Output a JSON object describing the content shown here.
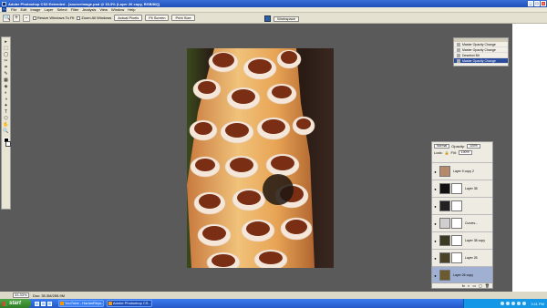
{
  "window": {
    "title": "Adobe Photoshop CS3 Extended - [sourceimage.psd @ 33.3% (Layer 26 copy, RGB/8#)]",
    "minimize": "_",
    "maximize": "□",
    "close": "x"
  },
  "menu": [
    "File",
    "Edit",
    "Image",
    "Layer",
    "Select",
    "Filter",
    "Analysis",
    "View",
    "Window",
    "Help"
  ],
  "options": {
    "tool_glyph": "🔍",
    "zoom_in": "+",
    "zoom_out": "-",
    "resize_windows": "Resize Windows To Fit",
    "zoom_all": "Zoom All Windows",
    "actual_pixels": "Actual Pixels",
    "fit_screen": "Fit Screen",
    "print_size": "Print Size",
    "workspace": "Workspace"
  },
  "tools": [
    "▸",
    "⬚",
    "◯",
    "✂",
    "⌗",
    "✎",
    "▦",
    "◈",
    "◐",
    "◑",
    "✦",
    "T",
    "⬠",
    "✋",
    "🔍"
  ],
  "history": {
    "items": [
      {
        "label": "Master Opacity Change",
        "active": false
      },
      {
        "label": "Master Opacity Change",
        "active": false
      },
      {
        "label": "Deselect Bit",
        "active": false
      },
      {
        "label": "Master Opacity Change",
        "active": true
      }
    ]
  },
  "layers": {
    "blend_mode": "Normal",
    "opacity_label": "Opacity:",
    "opacity_value": "100%",
    "lock_label": "Lock:",
    "fill_label": "Fill:",
    "fill_value": "100%",
    "rows": [
      {
        "name": "Layer 9 copy 2",
        "thumb": "#b48a6a",
        "mask": false,
        "selected": false
      },
      {
        "name": "Layer 38",
        "thumb": "#111111",
        "mask": true,
        "selected": false
      },
      {
        "name": "",
        "thumb": "#222222",
        "mask": true,
        "selected": false
      },
      {
        "name": "Curves...",
        "thumb": "#cfcfcf",
        "mask": true,
        "selected": false
      },
      {
        "name": "Layer 38 copy",
        "thumb": "#3d3a22",
        "mask": true,
        "selected": false
      },
      {
        "name": "Layer 26",
        "thumb": "#4a4226",
        "mask": true,
        "selected": false
      },
      {
        "name": "Layer 26 copy",
        "thumb": "#6b5a30",
        "mask": false,
        "selected": true
      }
    ],
    "bottom_icons": [
      "fx",
      "◐",
      "▭",
      "▢",
      "🗑"
    ]
  },
  "status": {
    "zoom": "33.33%",
    "doc_info": "Doc: 35.3M/255.9M"
  },
  "taskbar": {
    "start_label": "start",
    "tasks": [
      {
        "label": "YouTube - HarlanRhys...",
        "active": false
      },
      {
        "label": "Adobe Photoshop CS...",
        "active": true
      }
    ],
    "clock": "3:11 PM"
  },
  "colors": {
    "desktop": "#5a5a5a",
    "titlebar": "#2a5fcf",
    "accent": "#2c4c9c"
  }
}
